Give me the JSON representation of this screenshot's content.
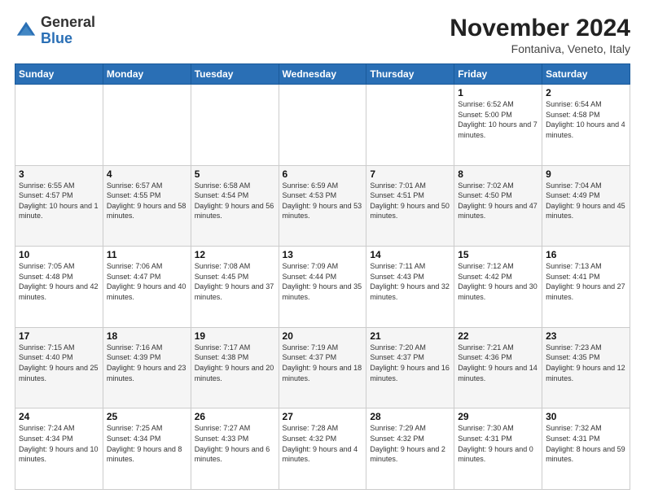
{
  "logo": {
    "general": "General",
    "blue": "Blue"
  },
  "title": "November 2024",
  "subtitle": "Fontaniva, Veneto, Italy",
  "days_of_week": [
    "Sunday",
    "Monday",
    "Tuesday",
    "Wednesday",
    "Thursday",
    "Friday",
    "Saturday"
  ],
  "weeks": [
    [
      {
        "day": "",
        "info": ""
      },
      {
        "day": "",
        "info": ""
      },
      {
        "day": "",
        "info": ""
      },
      {
        "day": "",
        "info": ""
      },
      {
        "day": "",
        "info": ""
      },
      {
        "day": "1",
        "info": "Sunrise: 6:52 AM\nSunset: 5:00 PM\nDaylight: 10 hours and 7 minutes."
      },
      {
        "day": "2",
        "info": "Sunrise: 6:54 AM\nSunset: 4:58 PM\nDaylight: 10 hours and 4 minutes."
      }
    ],
    [
      {
        "day": "3",
        "info": "Sunrise: 6:55 AM\nSunset: 4:57 PM\nDaylight: 10 hours and 1 minute."
      },
      {
        "day": "4",
        "info": "Sunrise: 6:57 AM\nSunset: 4:55 PM\nDaylight: 9 hours and 58 minutes."
      },
      {
        "day": "5",
        "info": "Sunrise: 6:58 AM\nSunset: 4:54 PM\nDaylight: 9 hours and 56 minutes."
      },
      {
        "day": "6",
        "info": "Sunrise: 6:59 AM\nSunset: 4:53 PM\nDaylight: 9 hours and 53 minutes."
      },
      {
        "day": "7",
        "info": "Sunrise: 7:01 AM\nSunset: 4:51 PM\nDaylight: 9 hours and 50 minutes."
      },
      {
        "day": "8",
        "info": "Sunrise: 7:02 AM\nSunset: 4:50 PM\nDaylight: 9 hours and 47 minutes."
      },
      {
        "day": "9",
        "info": "Sunrise: 7:04 AM\nSunset: 4:49 PM\nDaylight: 9 hours and 45 minutes."
      }
    ],
    [
      {
        "day": "10",
        "info": "Sunrise: 7:05 AM\nSunset: 4:48 PM\nDaylight: 9 hours and 42 minutes."
      },
      {
        "day": "11",
        "info": "Sunrise: 7:06 AM\nSunset: 4:47 PM\nDaylight: 9 hours and 40 minutes."
      },
      {
        "day": "12",
        "info": "Sunrise: 7:08 AM\nSunset: 4:45 PM\nDaylight: 9 hours and 37 minutes."
      },
      {
        "day": "13",
        "info": "Sunrise: 7:09 AM\nSunset: 4:44 PM\nDaylight: 9 hours and 35 minutes."
      },
      {
        "day": "14",
        "info": "Sunrise: 7:11 AM\nSunset: 4:43 PM\nDaylight: 9 hours and 32 minutes."
      },
      {
        "day": "15",
        "info": "Sunrise: 7:12 AM\nSunset: 4:42 PM\nDaylight: 9 hours and 30 minutes."
      },
      {
        "day": "16",
        "info": "Sunrise: 7:13 AM\nSunset: 4:41 PM\nDaylight: 9 hours and 27 minutes."
      }
    ],
    [
      {
        "day": "17",
        "info": "Sunrise: 7:15 AM\nSunset: 4:40 PM\nDaylight: 9 hours and 25 minutes."
      },
      {
        "day": "18",
        "info": "Sunrise: 7:16 AM\nSunset: 4:39 PM\nDaylight: 9 hours and 23 minutes."
      },
      {
        "day": "19",
        "info": "Sunrise: 7:17 AM\nSunset: 4:38 PM\nDaylight: 9 hours and 20 minutes."
      },
      {
        "day": "20",
        "info": "Sunrise: 7:19 AM\nSunset: 4:37 PM\nDaylight: 9 hours and 18 minutes."
      },
      {
        "day": "21",
        "info": "Sunrise: 7:20 AM\nSunset: 4:37 PM\nDaylight: 9 hours and 16 minutes."
      },
      {
        "day": "22",
        "info": "Sunrise: 7:21 AM\nSunset: 4:36 PM\nDaylight: 9 hours and 14 minutes."
      },
      {
        "day": "23",
        "info": "Sunrise: 7:23 AM\nSunset: 4:35 PM\nDaylight: 9 hours and 12 minutes."
      }
    ],
    [
      {
        "day": "24",
        "info": "Sunrise: 7:24 AM\nSunset: 4:34 PM\nDaylight: 9 hours and 10 minutes."
      },
      {
        "day": "25",
        "info": "Sunrise: 7:25 AM\nSunset: 4:34 PM\nDaylight: 9 hours and 8 minutes."
      },
      {
        "day": "26",
        "info": "Sunrise: 7:27 AM\nSunset: 4:33 PM\nDaylight: 9 hours and 6 minutes."
      },
      {
        "day": "27",
        "info": "Sunrise: 7:28 AM\nSunset: 4:32 PM\nDaylight: 9 hours and 4 minutes."
      },
      {
        "day": "28",
        "info": "Sunrise: 7:29 AM\nSunset: 4:32 PM\nDaylight: 9 hours and 2 minutes."
      },
      {
        "day": "29",
        "info": "Sunrise: 7:30 AM\nSunset: 4:31 PM\nDaylight: 9 hours and 0 minutes."
      },
      {
        "day": "30",
        "info": "Sunrise: 7:32 AM\nSunset: 4:31 PM\nDaylight: 8 hours and 59 minutes."
      }
    ]
  ]
}
